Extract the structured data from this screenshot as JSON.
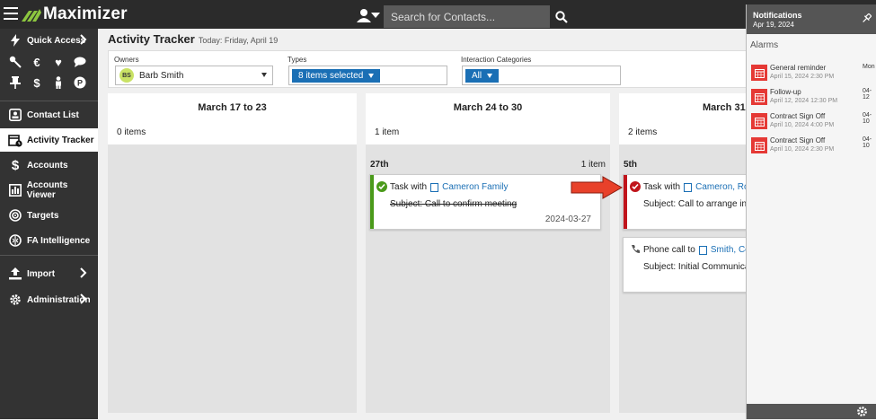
{
  "app": {
    "name": "Maximizer"
  },
  "search": {
    "placeholder": "Search for Contacts..."
  },
  "sidebar": {
    "items": [
      {
        "label": "Quick Access"
      },
      {
        "label": "Contact List"
      },
      {
        "label": "Activity Tracker"
      },
      {
        "label": "Accounts"
      },
      {
        "label": "Accounts Viewer"
      },
      {
        "label": "Targets"
      },
      {
        "label": "FA Intelligence"
      },
      {
        "label": "Import"
      },
      {
        "label": "Administration"
      }
    ]
  },
  "page": {
    "title": "Activity Tracker",
    "subtitle": "Today: Friday, April 19"
  },
  "filters": {
    "owners_label": "Owners",
    "owner_initials": "BS",
    "owner_name": "Barb Smith",
    "types_label": "Types",
    "types_value": "8 items selected",
    "categories_label": "Interaction Categories",
    "categories_value": "All"
  },
  "columns": [
    {
      "title": "March 17 to 23",
      "count": "0 items"
    },
    {
      "title": "March 24 to 30",
      "count": "1 item",
      "day": "27th",
      "day_count": "1 item",
      "cards": [
        {
          "prefix": "Task with",
          "contact": "Cameron Family",
          "subject": "Subject: Call to confirm meeting",
          "date": "2024-03-27"
        }
      ]
    },
    {
      "title": "March 31",
      "count": "2 items",
      "day": "5th",
      "cards": [
        {
          "prefix": "Task with",
          "contact": "Cameron, Rob",
          "subject": "Subject: Call to arrange in p"
        },
        {
          "prefix": "Phone call to",
          "contact": "Smith, Cel",
          "subject": "Subject: Initial Communica"
        }
      ]
    }
  ],
  "notifications": {
    "title": "Notifications",
    "date": "Apr 19, 2024",
    "alarms_title": "Alarms",
    "alarms": [
      {
        "name": "General reminder",
        "time": "April 15, 2024 2:30 PM",
        "side": "Mon"
      },
      {
        "name": "Follow-up",
        "time": "April 12, 2024 12:30 PM",
        "side": "04-12"
      },
      {
        "name": "Contract Sign Off",
        "time": "April 10, 2024 4:00 PM",
        "side": "04-10"
      },
      {
        "name": "Contract Sign Off",
        "time": "April 10, 2024 2:30 PM",
        "side": "04-10"
      }
    ]
  },
  "colors": {
    "accent": "#1a6fb5",
    "complete_green": "#4a9a1a",
    "overdue_red": "#c0141b",
    "alarm_red": "#e53935",
    "logo_green": "#8cc63f"
  }
}
